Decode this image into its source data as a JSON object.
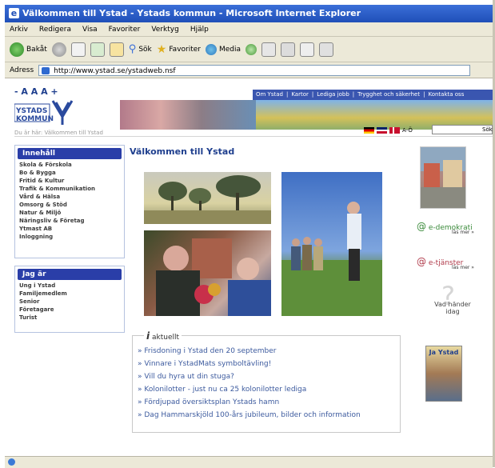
{
  "window": {
    "title": "Välkommen till Ystad - Ystads kommun - Microsoft Internet Explorer"
  },
  "menu": [
    "Arkiv",
    "Redigera",
    "Visa",
    "Favoriter",
    "Verktyg",
    "Hjälp"
  ],
  "toolbar": {
    "back": "Bakåt",
    "search": "Sök",
    "favorites": "Favoriter",
    "media": "Media"
  },
  "address": {
    "label": "Adress",
    "url": "http://www.ystad.se/ystadweb.nsf"
  },
  "header": {
    "font_size_control": "- A A A +",
    "logo_line1": "YSTADS",
    "logo_line2": "KOMMUN",
    "breadcrumb": "Du är här: Välkommen till Ystad",
    "top_nav": [
      "Om Ystad",
      "Kartor",
      "Lediga jobb",
      "Trygghet och säkerhet",
      "Kontakta oss"
    ],
    "az": "A-Ö",
    "search_label": "Sök"
  },
  "left_nav": {
    "innehall_title": "Innehåll",
    "innehall_items": [
      "Skola & Förskola",
      "Bo & Bygga",
      "Fritid & Kultur",
      "Trafik & Kommunikation",
      "Vård & Hälsa",
      "Omsorg & Stöd",
      "Natur & Miljö",
      "Näringsliv & Företag",
      "Ytmast AB",
      "Inloggning"
    ],
    "jagar_title": "Jag är",
    "jagar_items": [
      "Ung i Ystad",
      "Familjemedlem",
      "Senior",
      "Företagare",
      "Turist"
    ]
  },
  "main": {
    "title": "Välkommen till Ystad",
    "news_header": "aktuellt",
    "news": [
      "Frisdoning i Ystad den 20 september",
      "Vinnare i YstadMats symboltävling!",
      "Vill du hyra ut din stuga?",
      "Kolonilotter - just nu ca 25 kolonilotter lediga",
      "Fördjupad översiktsplan Ystads hamn",
      "Dag Hammarskjöld 100-års jubileum, bilder och information"
    ]
  },
  "right": {
    "demokrati": "e-demokrati",
    "demokrati_sub": "läs mer »",
    "tjanster": "e-tjänster",
    "tjanster_sub": "läs mer »",
    "vad": "Vad händer idag",
    "magazine": "Ja Ystad"
  }
}
